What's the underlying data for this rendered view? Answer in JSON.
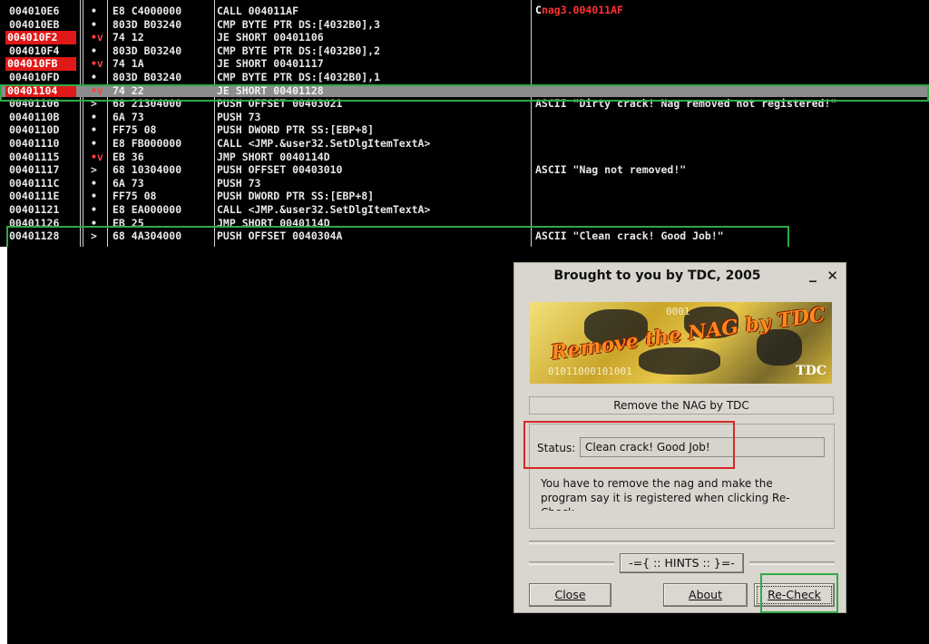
{
  "disassembly": {
    "rows": [
      {
        "addr": "004010E6",
        "mark": "•",
        "hex": "E8 C4000000",
        "ins": "CALL 004011AF",
        "cmt": "",
        "addr_red": false
      },
      {
        "addr": "004010EB",
        "mark": "•",
        "hex": "803D B03240",
        "ins": "CMP BYTE PTR DS:[4032B0],3",
        "cmt": "",
        "addr_red": false
      },
      {
        "addr": "004010F2",
        "mark": "•v",
        "hex": "74 12",
        "ins": "JE SHORT 00401106",
        "cmt": "",
        "addr_red": true
      },
      {
        "addr": "004010F4",
        "mark": "•",
        "hex": "803D B03240",
        "ins": "CMP BYTE PTR DS:[4032B0],2",
        "cmt": "",
        "addr_red": false
      },
      {
        "addr": "004010FB",
        "mark": "•v",
        "hex": "74 1A",
        "ins": "JE SHORT 00401117",
        "cmt": "",
        "addr_red": true
      },
      {
        "addr": "004010FD",
        "mark": "•",
        "hex": "803D B03240",
        "ins": "CMP BYTE PTR DS:[4032B0],1",
        "cmt": "",
        "addr_red": false
      },
      {
        "addr": "00401104",
        "mark": "•v",
        "hex": "74 22",
        "ins": "JE SHORT 00401128",
        "cmt": "",
        "addr_red": true,
        "selected": true
      },
      {
        "addr": "00401106",
        "mark": ">",
        "hex": "68 21304000",
        "ins": "PUSH OFFSET 00403021",
        "cmt": "ASCII \"Dirty crack! Nag removed not registered!\"",
        "addr_red": false
      },
      {
        "addr": "0040110B",
        "mark": "•",
        "hex": "6A 73",
        "ins": "PUSH 73",
        "cmt": "",
        "addr_red": false
      },
      {
        "addr": "0040110D",
        "mark": "•",
        "hex": "FF75 08",
        "ins": "PUSH DWORD PTR SS:[EBP+8]",
        "cmt": "",
        "addr_red": false
      },
      {
        "addr": "00401110",
        "mark": "•",
        "hex": "E8 FB000000",
        "ins": "CALL <JMP.&user32.SetDlgItemTextA>",
        "cmt": "",
        "addr_red": false
      },
      {
        "addr": "00401115",
        "mark": "•v",
        "hex": "EB 36",
        "ins": "JMP SHORT 0040114D",
        "cmt": "",
        "addr_red": false
      },
      {
        "addr": "00401117",
        "mark": ">",
        "hex": "68 10304000",
        "ins": "PUSH OFFSET 00403010",
        "cmt": "ASCII \"Nag not removed!\"",
        "addr_red": false
      },
      {
        "addr": "0040111C",
        "mark": "•",
        "hex": "6A 73",
        "ins": "PUSH 73",
        "cmt": "",
        "addr_red": false
      },
      {
        "addr": "0040111E",
        "mark": "•",
        "hex": "FF75 08",
        "ins": "PUSH DWORD PTR SS:[EBP+8]",
        "cmt": "",
        "addr_red": false
      },
      {
        "addr": "00401121",
        "mark": "•",
        "hex": "E8 EA000000",
        "ins": "CALL <JMP.&user32.SetDlgItemTextA>",
        "cmt": "",
        "addr_red": false
      },
      {
        "addr": "00401126",
        "mark": "•",
        "hex": "EB 25",
        "ins": "JMP SHORT 0040114D",
        "cmt": "",
        "addr_red": false
      },
      {
        "addr": "00401128",
        "mark": ">",
        "hex": "68 4A304000",
        "ins": "PUSH OFFSET 0040304A",
        "cmt": "ASCII \"Clean crack! Good Job!\"",
        "addr_red": false
      }
    ],
    "top_comment_glyph": "C",
    "top_comment": "nag3.004011AF"
  },
  "dialog": {
    "title": "Brought to you by TDC, 2005",
    "minimize": "_",
    "close": "✕",
    "banner_text": "Remove the NAG by TDC",
    "banner_logo": "TDC",
    "banner_overlay_1": "0001",
    "banner_overlay_2": "01011000101001",
    "subtitle": "Remove the NAG by TDC",
    "status_label": "Status:",
    "status_value": "Clean crack! Good Job!",
    "info_text": "You have to remove the nag and make the program say it is registered when clicking Re-Check",
    "hints_button": "-={ :: HINTS :: }=-",
    "close_button": "Close",
    "about_button": "About",
    "recheck_button": "Re-Check"
  },
  "colors": {
    "highlight_green": "#2faa44",
    "highlight_red": "#d62828",
    "address_red": "#e01818"
  }
}
